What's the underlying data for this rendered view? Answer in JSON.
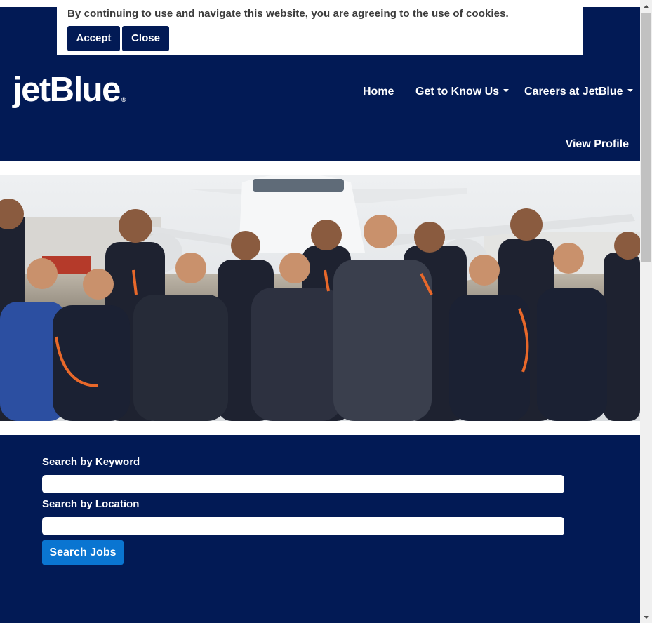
{
  "cookie_banner": {
    "message": "By continuing to use and navigate this website, you are agreeing to the use of cookies.",
    "accept_label": "Accept",
    "close_label": "Close"
  },
  "header": {
    "logo_text": "jetBlue",
    "logo_mark": "®",
    "nav": {
      "home": "Home",
      "get_to_know": "Get to Know Us",
      "careers": "Careers at JetBlue",
      "view_profile": "View Profile"
    }
  },
  "hero": {
    "image": "crew-photo"
  },
  "search": {
    "keyword_label": "Search by Keyword",
    "keyword_value": "",
    "location_label": "Search by Location",
    "location_value": "",
    "button_label": "Search Jobs"
  },
  "colors": {
    "navy": "#021a55",
    "button_blue": "#0a75d1",
    "orange_accent": "#e8682a"
  }
}
